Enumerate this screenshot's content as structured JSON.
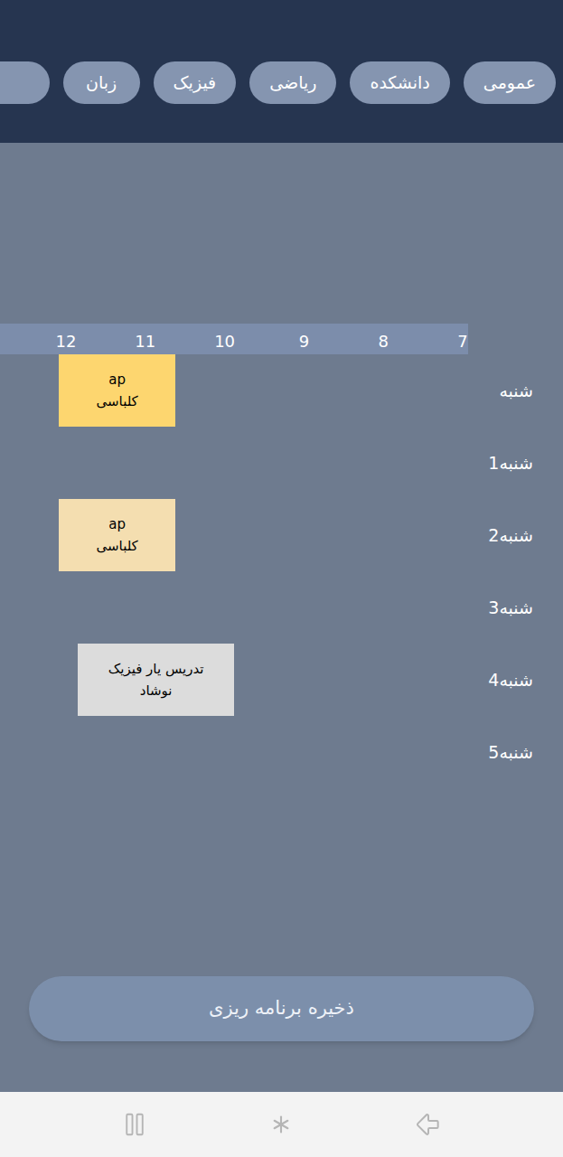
{
  "tabs": [
    {
      "label": "عمومی",
      "selected": false
    },
    {
      "label": "دانشکده",
      "selected": false
    },
    {
      "label": "ریاضی",
      "selected": false
    },
    {
      "label": "فیزیک",
      "selected": false
    },
    {
      "label": "زبان",
      "selected": false
    }
  ],
  "timeline": {
    "hours": [
      "12",
      "11",
      "10",
      "9",
      "8",
      "7"
    ]
  },
  "days": [
    {
      "label": "شنبه",
      "entries": [
        {
          "title": "ap",
          "teacher": "کلباسی",
          "color": "#fdd66f",
          "from": 10.62,
          "to": 12.09
        }
      ]
    },
    {
      "label": "1شنبه",
      "entries": []
    },
    {
      "label": "2شنبه",
      "entries": [
        {
          "title": "ap",
          "teacher": "کلباسی",
          "color": "#f4deb0",
          "from": 10.62,
          "to": 12.09
        }
      ]
    },
    {
      "label": "3شنبه",
      "entries": []
    },
    {
      "label": "4شنبه",
      "entries": [
        {
          "title": "تدریس یار فیزیک",
          "teacher": "نوشاد",
          "color": "#dcdcdc",
          "from": 9.88,
          "to": 11.85
        }
      ]
    },
    {
      "label": "5شنبه",
      "entries": []
    }
  ],
  "save_button": "ذخیره برنامه ریزی"
}
